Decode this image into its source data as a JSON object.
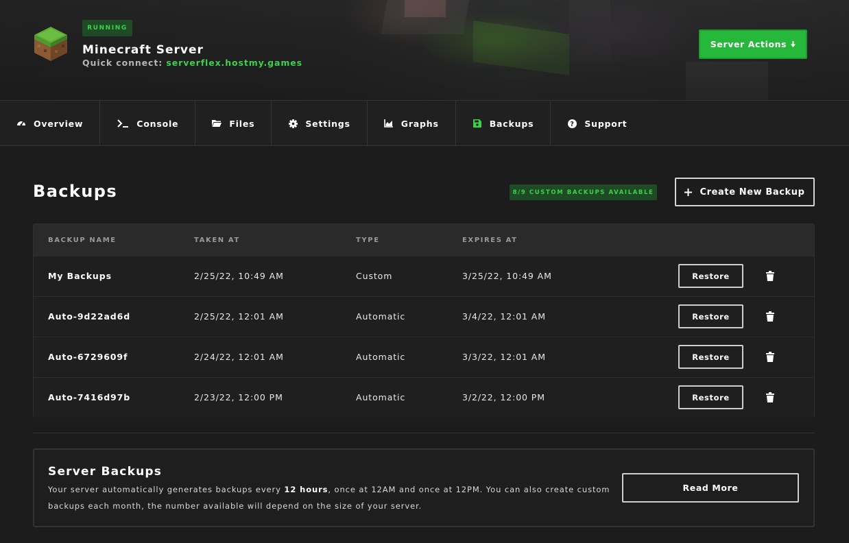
{
  "colors": {
    "accent": "#3fd04b",
    "button_green": "#26b83b",
    "background": "#1c1c1c"
  },
  "server": {
    "status": "RUNNING",
    "name": "Minecraft Server",
    "quick_connect_label": "Quick connect:",
    "quick_connect_host": "serverflex.hostmy.games",
    "icon": "minecraft-grass-block-icon",
    "actions_label": "Server Actions"
  },
  "tabs": [
    {
      "label": "Overview",
      "icon": "dashboard-icon"
    },
    {
      "label": "Console",
      "icon": "terminal-icon"
    },
    {
      "label": "Files",
      "icon": "folder-icon"
    },
    {
      "label": "Settings",
      "icon": "gear-icon"
    },
    {
      "label": "Graphs",
      "icon": "chart-icon"
    },
    {
      "label": "Backups",
      "icon": "save-icon",
      "active": true
    },
    {
      "label": "Support",
      "icon": "help-icon"
    }
  ],
  "page": {
    "title": "Backups",
    "available_badge": "8/9 CUSTOM BACKUPS AVAILABLE",
    "create_button": "Create New Backup"
  },
  "table": {
    "columns": [
      "BACKUP NAME",
      "TAKEN AT",
      "TYPE",
      "EXPIRES AT"
    ],
    "restore_label": "Restore",
    "rows": [
      {
        "name": "My Backups",
        "taken_at": "2/25/22, 10:49 AM",
        "type": "Custom",
        "expires_at": "3/25/22, 10:49 AM"
      },
      {
        "name": "Auto-9d22ad6d",
        "taken_at": "2/25/22, 12:01 AM",
        "type": "Automatic",
        "expires_at": "3/4/22, 12:01 AM"
      },
      {
        "name": "Auto-6729609f",
        "taken_at": "2/24/22, 12:01 AM",
        "type": "Automatic",
        "expires_at": "3/3/22, 12:01 AM"
      },
      {
        "name": "Auto-7416d97b",
        "taken_at": "2/23/22, 12:00 PM",
        "type": "Automatic",
        "expires_at": "3/2/22, 12:00 PM"
      }
    ]
  },
  "info": {
    "title": "Server Backups",
    "text_before": "Your server automatically generates backups every ",
    "text_bold": "12 hours",
    "text_after": ", once at 12AM and once at 12PM. You can also create custom backups each month, the number available will depend on the size of your server.",
    "read_more": "Read More"
  }
}
